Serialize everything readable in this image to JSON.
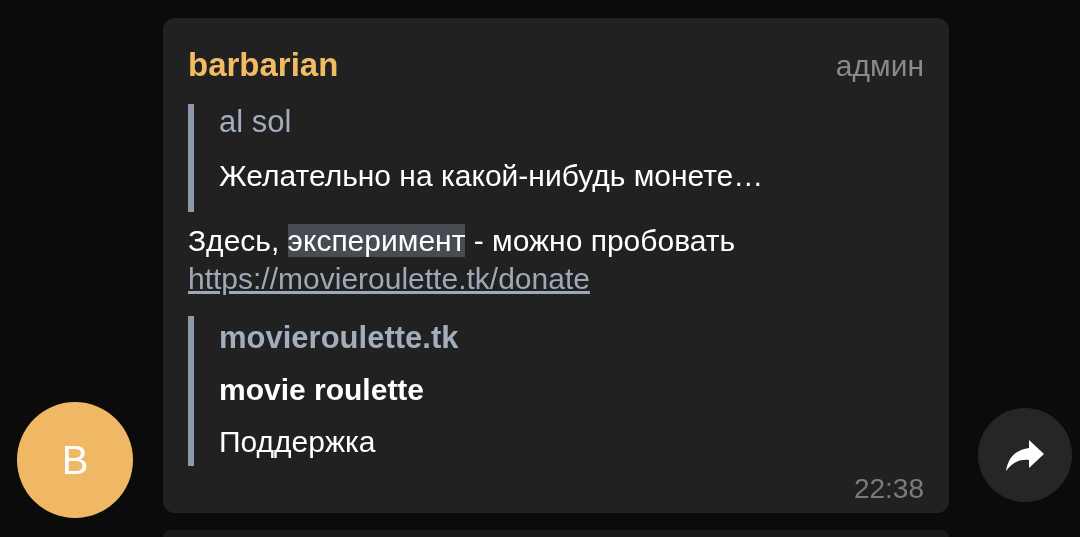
{
  "message": {
    "sender": "barbarian",
    "role": "админ",
    "reply": {
      "author": "al sol",
      "text": "Желательно на какой-нибудь монете…"
    },
    "text_segments": [
      {
        "text": "Здесь, ",
        "highlighted": false
      },
      {
        "text": "эксперимент",
        "highlighted": true
      },
      {
        "text": " - можно пробовать",
        "highlighted": false
      }
    ],
    "link": "https://movieroulette.tk/donate",
    "preview": {
      "site": "movieroulette.tk",
      "title": "movie roulette",
      "description": "Поддержка"
    },
    "time": "22:38",
    "avatar_letter": "B"
  }
}
